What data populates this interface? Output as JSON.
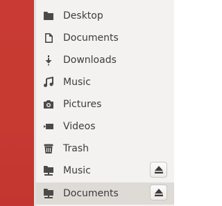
{
  "sidebar": {
    "items": [
      {
        "label": "Desktop",
        "icon": "folder-icon"
      },
      {
        "label": "Documents",
        "icon": "document-icon"
      },
      {
        "label": "Downloads",
        "icon": "download-icon"
      },
      {
        "label": "Music",
        "icon": "music-note-icon"
      },
      {
        "label": "Pictures",
        "icon": "camera-icon"
      },
      {
        "label": "Videos",
        "icon": "video-camera-icon"
      },
      {
        "label": "Trash",
        "icon": "trash-icon"
      },
      {
        "label": "Music",
        "icon": "network-folder-icon",
        "ejectable": true
      },
      {
        "label": "Documents",
        "icon": "network-folder-icon",
        "ejectable": true,
        "selected": true
      }
    ]
  },
  "colors": {
    "desktop_red": "#c83a33",
    "sidebar_bg": "#f3f2f0",
    "selected_bg": "#dedbd7",
    "text": "#3c3c3c",
    "icon": "#4a4a4a"
  }
}
